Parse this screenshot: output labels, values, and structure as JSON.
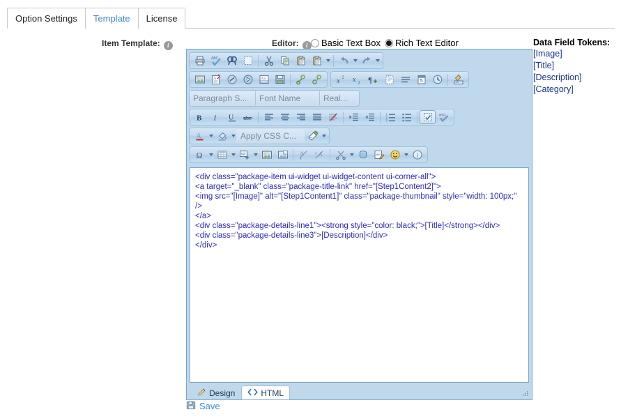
{
  "tabs": [
    {
      "label": "Option Settings",
      "active": false
    },
    {
      "label": "Template",
      "active": true
    },
    {
      "label": "License",
      "active": false
    }
  ],
  "form": {
    "item_template_label": "Item Template:",
    "editor_label": "Editor:",
    "info_glyph": "i"
  },
  "editor_mode": {
    "options": [
      {
        "label": "Basic Text Box",
        "checked": false
      },
      {
        "label": "Rich Text Editor",
        "checked": true
      }
    ]
  },
  "tokens": {
    "title": "Data Field Tokens:",
    "items": [
      "[Image]",
      "[Title]",
      "[Description]",
      "[Category]"
    ]
  },
  "toolbar": {
    "row1": [
      "print-icon",
      "spellcheck-icon",
      "find-replace-icon",
      "select-all-icon",
      "cut-icon",
      "copy-icon",
      "paste-icon",
      "paste-options-icon",
      "undo-icon",
      "redo-icon"
    ],
    "row2_left": [
      "insert-image-icon",
      "insert-document-icon",
      "insert-flash-icon",
      "insert-media-icon",
      "insert-template-icon",
      "save-disk-icon",
      "hyperlink-icon",
      "remove-link-icon"
    ],
    "row2_right": [
      "superscript-icon",
      "subscript-icon",
      "format-paragraph-icon",
      "insert-paragraph-icon",
      "horizontal-rule-icon",
      "insert-date-icon",
      "insert-time-icon",
      "format-code-block-icon"
    ],
    "row3_selects": [
      "Paragraph S...",
      "Font Name",
      "Real..."
    ],
    "row4": [
      "bold-icon",
      "italic-icon",
      "underline-icon",
      "strikethrough-icon",
      "align-left-icon",
      "align-center-icon",
      "align-right-icon",
      "justify-icon",
      "remove-formatting-icon",
      "indent-icon",
      "outdent-icon",
      "numbered-list-icon",
      "bulleted-list-icon",
      "module-manager-icon",
      "w3c-validate-icon"
    ],
    "row5": {
      "foreground_color": "foreground-color-icon",
      "background_color": "background-color-icon",
      "apply_css_label": "Apply CSS C...",
      "format_painter": "format-painter-icon"
    },
    "row6": [
      "insert-symbol-icon",
      "insert-table-icon",
      "insert-snippet-icon",
      "image-map-editor-icon",
      "image-manager-icon",
      "strip-formatting-icon",
      "change-case-icon",
      "cut-tool-icon",
      "silverlight-icon",
      "annotation-icon",
      "emoticon-icon",
      "about-icon"
    ]
  },
  "code": {
    "value": "<div class=\"package-item ui-widget ui-widget-content ui-corner-all\">\n<a target=\"_blank\" class=\"package-title-link\" href=\"[Step1Content2]\">\n<img src=\"[Image]\" alt=\"[Step1Content1]\" class=\"package-thumbnail\" style=\"width: 100px;\" />\n</a>\n<div class=\"package-details-line1\"><strong style=\"color: black;\">[Title]</strong></div>\n<div class=\"package-details-line3\">[Description]</div>\n</div>"
  },
  "mode_tabs": [
    {
      "label": "Design",
      "active": false,
      "icon": "pencil-icon"
    },
    {
      "label": "HTML",
      "active": true,
      "icon": "code-brackets-icon"
    }
  ],
  "save": {
    "label": "Save",
    "icon": "floppy-disk-icon"
  },
  "colors": {
    "accent": "#3d8bd4",
    "editor_chrome": "#bfd8ec",
    "editor_border": "#7aa7cc",
    "token_text": "#16348c",
    "code_text": "#2b2bc0"
  }
}
